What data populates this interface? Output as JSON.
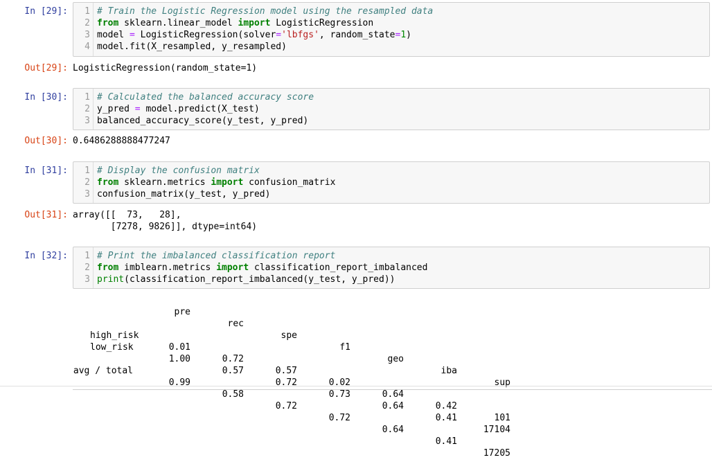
{
  "cells": [
    {
      "in_prompt": "In [29]:",
      "lines": [
        {
          "n": "1",
          "text": "# Train the Logistic Regression model using the resampled data"
        },
        {
          "n": "2",
          "text": "from sklearn.linear_model import LogisticRegression"
        },
        {
          "n": "3",
          "text": "model = LogisticRegression(solver='lbfgs', random_state=1)"
        },
        {
          "n": "4",
          "text": "model.fit(X_resampled, y_resampled)"
        }
      ],
      "out_prompt": "Out[29]:",
      "output": "LogisticRegression(random_state=1)"
    },
    {
      "in_prompt": "In [30]:",
      "lines": [
        {
          "n": "1",
          "text": "# Calculated the balanced accuracy score"
        },
        {
          "n": "2",
          "text": "y_pred = model.predict(X_test)"
        },
        {
          "n": "3",
          "text": "balanced_accuracy_score(y_test, y_pred)"
        }
      ],
      "out_prompt": "Out[30]:",
      "output": "0.6486288888477247"
    },
    {
      "in_prompt": "In [31]:",
      "lines": [
        {
          "n": "1",
          "text": "# Display the confusion matrix"
        },
        {
          "n": "2",
          "text": "from sklearn.metrics import confusion_matrix"
        },
        {
          "n": "3",
          "text": "confusion_matrix(y_test, y_pred)"
        }
      ],
      "out_prompt": "Out[31]:",
      "output": "array([[  73,   28],\n       [7278, 9826]], dtype=int64)"
    },
    {
      "in_prompt": "In [32]:",
      "lines": [
        {
          "n": "1",
          "text": "# Print the imbalanced classification report"
        },
        {
          "n": "2",
          "text": "from imblearn.metrics import classification_report_imbalanced"
        },
        {
          "n": "3",
          "text": "print(classification_report_imbalanced(y_test, y_pred))"
        }
      ]
    }
  ],
  "report": {
    "headers": [
      "pre",
      "rec",
      "spe",
      "f1",
      "geo",
      "iba",
      "sup"
    ],
    "rows": [
      {
        "label": "high_risk",
        "values": [
          "0.01",
          "0.72",
          "0.57",
          "0.02",
          "0.64",
          "0.42",
          "101"
        ]
      },
      {
        "label": "low_risk",
        "values": [
          "1.00",
          "0.57",
          "0.72",
          "0.73",
          "0.64",
          "0.41",
          "17104"
        ]
      }
    ],
    "total": {
      "label": "avg / total",
      "values": [
        "0.99",
        "0.58",
        "0.72",
        "0.72",
        "0.64",
        "0.41",
        "17205"
      ]
    }
  }
}
